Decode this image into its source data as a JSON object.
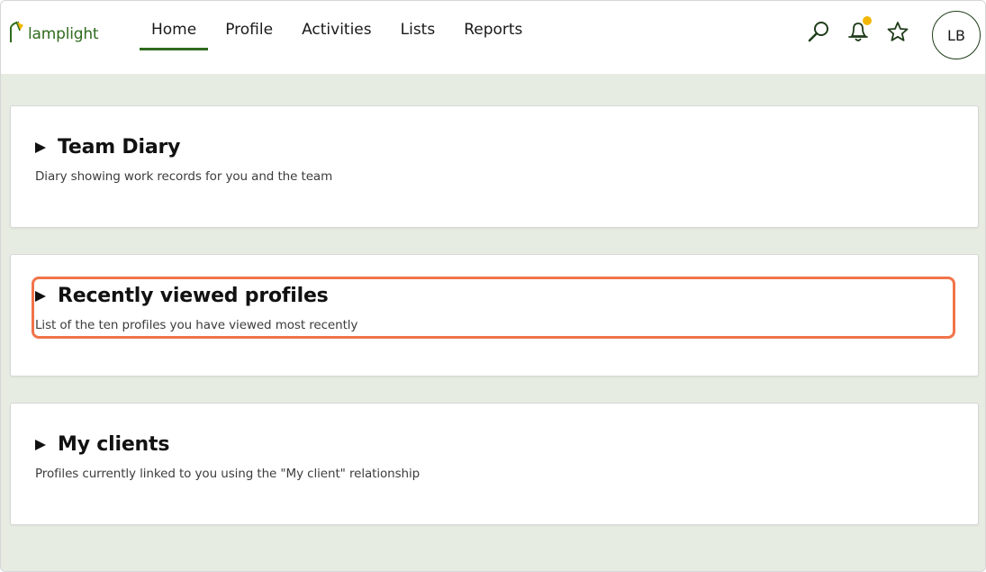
{
  "app": {
    "logo_text": "lamplight",
    "brand_color": "#2f6b1e"
  },
  "nav": {
    "items": [
      {
        "label": "Home",
        "active": true
      },
      {
        "label": "Profile"
      },
      {
        "label": "Activities"
      },
      {
        "label": "Lists"
      },
      {
        "label": "Reports"
      }
    ]
  },
  "header_icons": {
    "search": "search-icon",
    "notifications": "bell-icon",
    "favourites": "star-icon",
    "notification_dot_color": "#f2b705"
  },
  "user": {
    "initials": "LB"
  },
  "cards": [
    {
      "title": "Team Diary",
      "description": "Diary showing work records for you and the team"
    },
    {
      "title": "Recently viewed profiles",
      "description": "List of the ten profiles you have viewed most recently",
      "highlighted": true
    },
    {
      "title": "My clients",
      "description": "Profiles currently linked to you using the \"My client\" relationship"
    }
  ],
  "highlight_color": "#f0744a"
}
